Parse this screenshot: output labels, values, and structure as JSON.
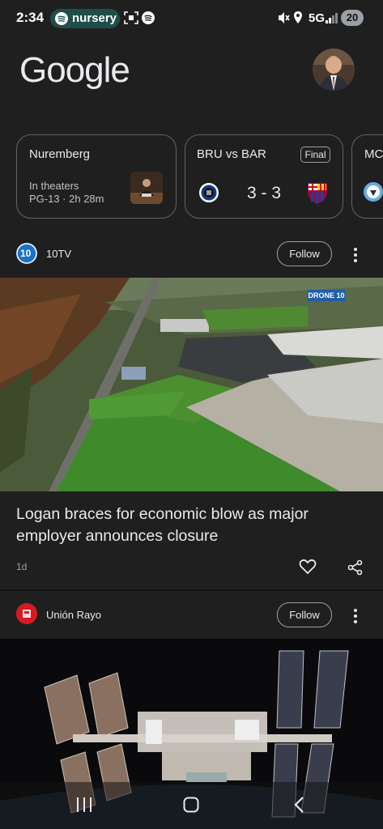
{
  "status_bar": {
    "time": "2:34",
    "spotify_pill": "nursery",
    "network": "5G",
    "battery": "20"
  },
  "header": {
    "logo": "Google"
  },
  "cards": [
    {
      "title": "Nuremberg",
      "line1": "In theaters",
      "line2": "PG-13 · 2h 28m"
    },
    {
      "title": "BRU vs BAR",
      "badge": "Final",
      "score": "3 - 3"
    },
    {
      "title": "MC"
    }
  ],
  "feed": [
    {
      "source": "10TV",
      "follow": "Follow",
      "headline": "Logan braces for economic blow as major employer announces closure",
      "age": "1d",
      "image_badge": "DRONE 10"
    },
    {
      "source": "Unión Rayo",
      "follow": "Follow"
    }
  ],
  "colors": {
    "background": "#1f1f1f",
    "card_border": "#5f6368",
    "spotify_pill": "#1f4d4a",
    "rayo_red": "#d71920",
    "tv10_blue": "#1a73c8"
  },
  "icons": [
    "spotify-icon",
    "screenshot-icon",
    "mute-icon",
    "location-icon",
    "signal-icon",
    "heart-icon",
    "share-icon",
    "more-icon",
    "recents-icon",
    "home-icon",
    "back-icon"
  ]
}
